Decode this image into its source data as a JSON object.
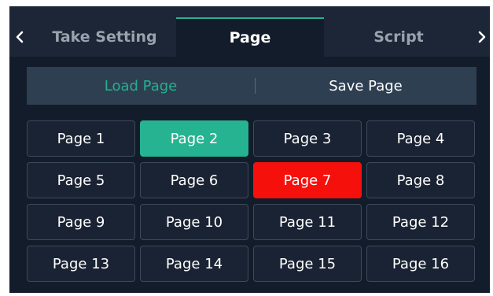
{
  "tabs": {
    "take_setting": "Take Setting",
    "page": "Page",
    "script": "Script",
    "active": "Page"
  },
  "actions": {
    "load": "Load Page",
    "save": "Save Page",
    "active": "Load Page"
  },
  "pages": [
    {
      "label": "Page 1",
      "state": "normal"
    },
    {
      "label": "Page 2",
      "state": "loaded"
    },
    {
      "label": "Page 3",
      "state": "normal"
    },
    {
      "label": "Page 4",
      "state": "normal"
    },
    {
      "label": "Page 5",
      "state": "normal"
    },
    {
      "label": "Page 6",
      "state": "normal"
    },
    {
      "label": "Page 7",
      "state": "current"
    },
    {
      "label": "Page 8",
      "state": "normal"
    },
    {
      "label": "Page 9",
      "state": "normal"
    },
    {
      "label": "Page 10",
      "state": "normal"
    },
    {
      "label": "Page 11",
      "state": "normal"
    },
    {
      "label": "Page 12",
      "state": "normal"
    },
    {
      "label": "Page 13",
      "state": "normal"
    },
    {
      "label": "Page 14",
      "state": "normal"
    },
    {
      "label": "Page 15",
      "state": "normal"
    },
    {
      "label": "Page 16",
      "state": "normal"
    }
  ],
  "colors": {
    "accent": "#26b391",
    "current": "#f5100c",
    "panel": "#131c2a"
  },
  "icons": {
    "left": "chevron-left-icon",
    "right": "chevron-right-icon"
  }
}
